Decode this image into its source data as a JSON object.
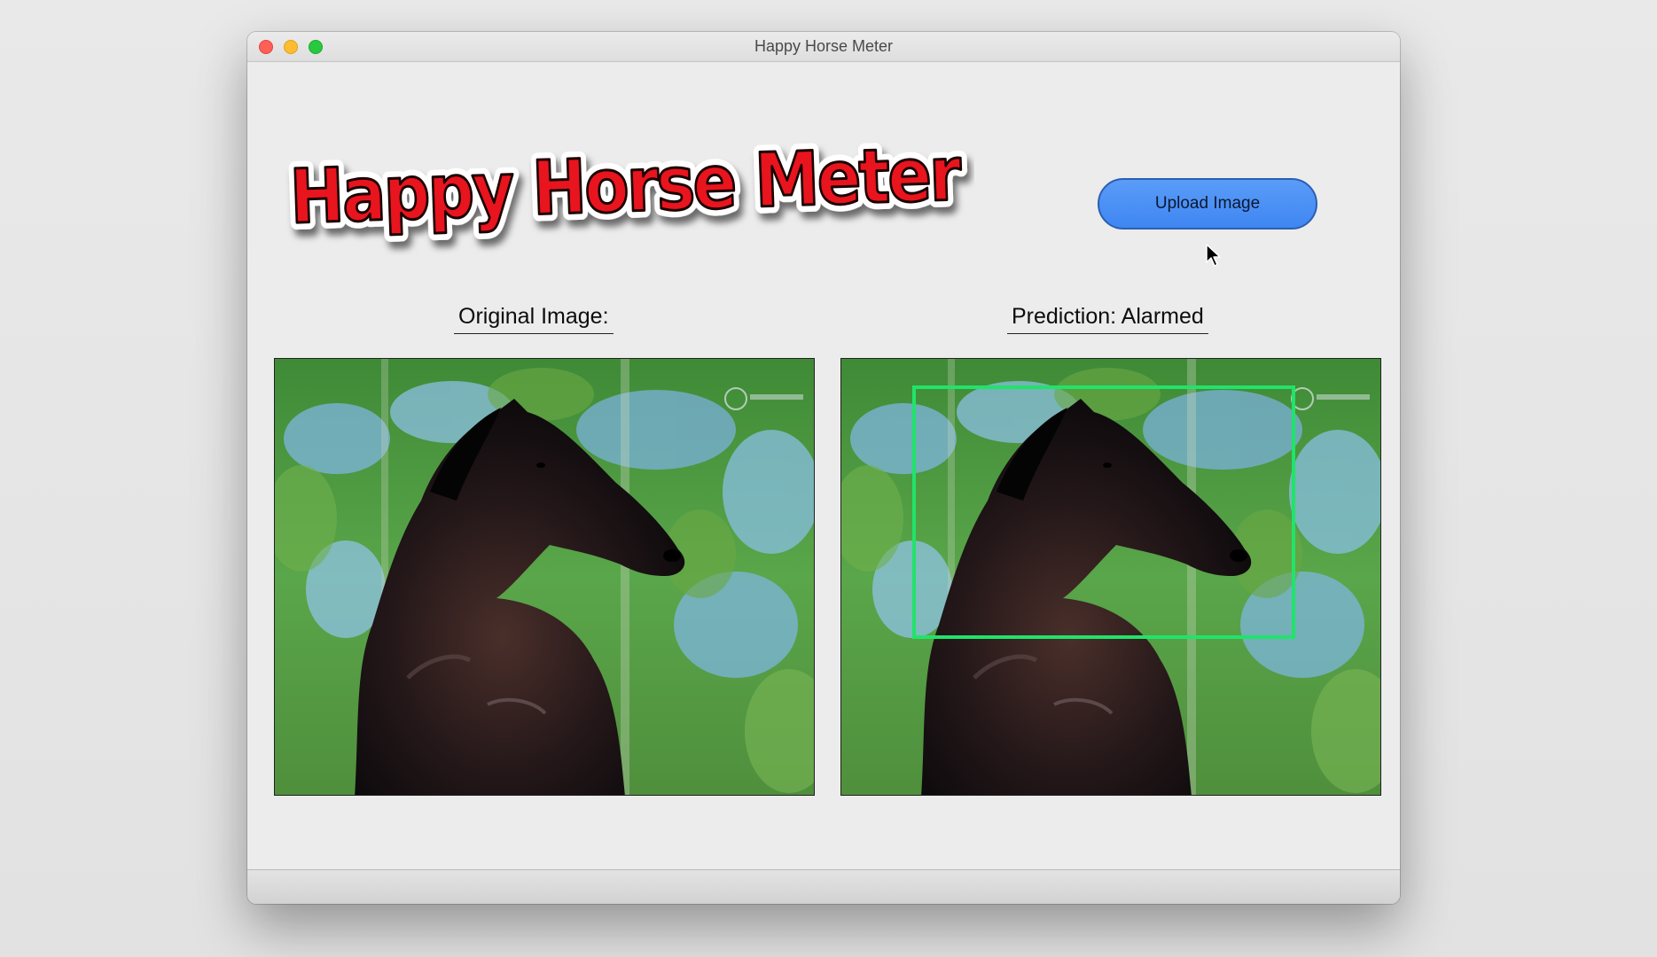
{
  "window": {
    "title": "Happy Horse Meter"
  },
  "header": {
    "logo_text": "Happy Horse Meter",
    "upload_label": "Upload Image"
  },
  "panels": {
    "original_caption": "Original Image:",
    "prediction_caption": "Prediction: Alarmed"
  },
  "icons": {
    "close": "close-icon",
    "minimize": "minimize-icon",
    "maximize": "maximize-icon",
    "cursor": "mouse-pointer-icon"
  },
  "colors": {
    "accent_button": "#4a8ff5",
    "logo_red": "#e8141e",
    "prediction_box": "#21e36a"
  }
}
